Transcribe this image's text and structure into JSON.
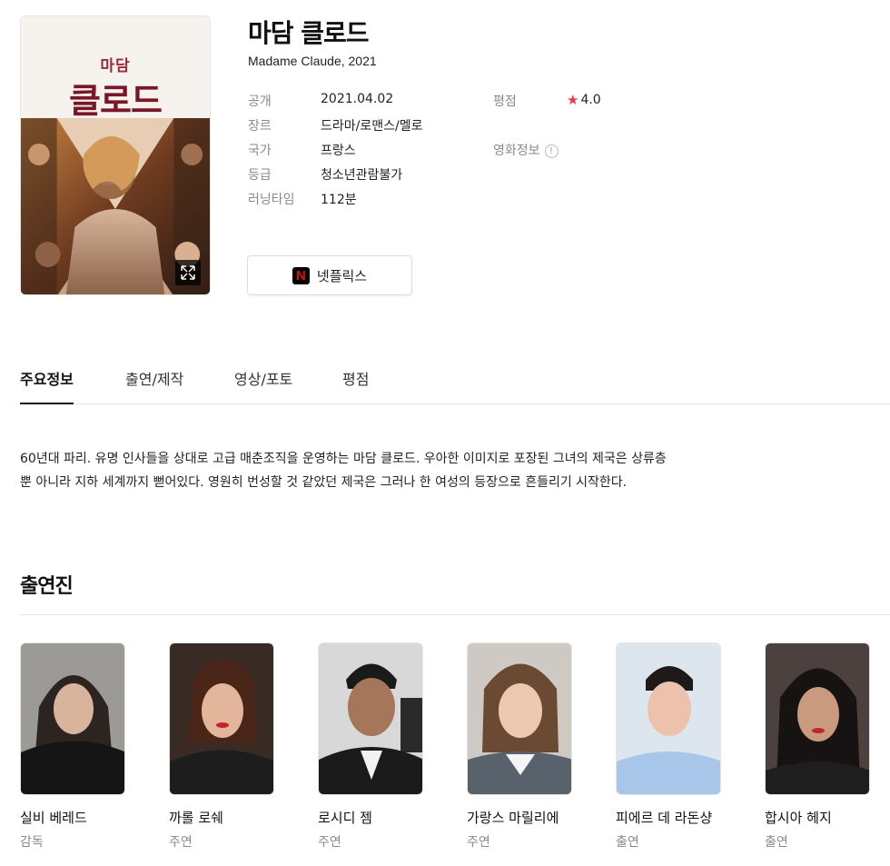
{
  "movie": {
    "title": "마담 클로드",
    "subtitle": "Madame Claude, 2021",
    "poster": {
      "title_small": "마담",
      "title_big": "클로드"
    }
  },
  "info": {
    "release_label": "공개",
    "release_value": "2021.04.02",
    "genre_label": "장르",
    "genre_value": "드라마/로맨스/멜로",
    "country_label": "국가",
    "country_value": "프랑스",
    "rating_class_label": "등급",
    "rating_class_value": "청소년관람불가",
    "runtime_label": "러닝타임",
    "runtime_value": "112분",
    "score_label": "평점",
    "score_value": "4.0",
    "movieinfo_label": "영화정보"
  },
  "streaming": {
    "label": "넷플릭스",
    "logo_letter": "N"
  },
  "tabs": [
    {
      "label": "주요정보"
    },
    {
      "label": "출연/제작"
    },
    {
      "label": "영상/포토"
    },
    {
      "label": "평점"
    }
  ],
  "synopsis": {
    "line1": "60년대 파리. 유명 인사들을 상대로 고급 매춘조직을 운영하는 마담 클로드. 우아한 이미지로 포장된 그녀의 제국은 상류층",
    "line2": "뿐 아니라 지하 세계까지 뻗어있다. 영원히 번성할 것 같았던 제국은 그러나 한 여성의 등장으로 흔들리기 시작한다."
  },
  "cast": {
    "title": "출연진",
    "members": [
      {
        "name": "실비 베레드",
        "role": "감독"
      },
      {
        "name": "까롤 로쉐",
        "role": "주연"
      },
      {
        "name": "로시디 젬",
        "role": "주연"
      },
      {
        "name": "가랑스 마릴리에",
        "role": "주연"
      },
      {
        "name": "피에르 데 라돈샹",
        "role": "출연"
      },
      {
        "name": "합시아 헤지",
        "role": "출연"
      }
    ]
  },
  "colors": {
    "accent_star": "#ff2f4e",
    "netflix_red": "#e50914"
  },
  "icons": [
    "expand-icon",
    "star-icon",
    "info-icon",
    "netflix-logo-icon"
  ]
}
